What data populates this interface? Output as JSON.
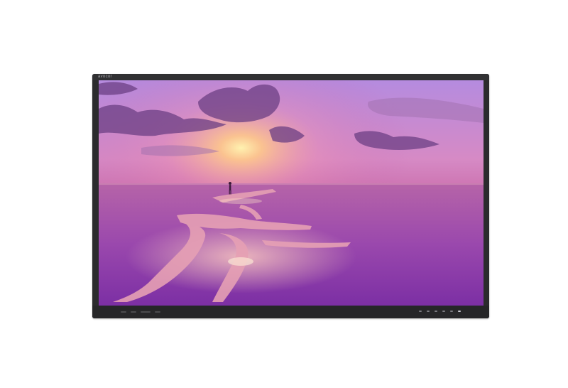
{
  "monitor": {
    "brand_label": "avocor",
    "screen_image": "sunset-salt-flats-wallpaper",
    "front_ports": [
      "usb-port",
      "usb-port",
      "hdmi-port",
      "usb-c-port"
    ],
    "front_buttons": [
      "input-button",
      "volume-down-button",
      "volume-up-button",
      "menu-button",
      "power-button",
      "power-led"
    ]
  },
  "colors": {
    "bezel": "#2b2b2d",
    "sky_top": "#b77ad6",
    "sun": "#ffd98a",
    "water": "#8f3fb0",
    "salt": "#e9a7b8"
  }
}
